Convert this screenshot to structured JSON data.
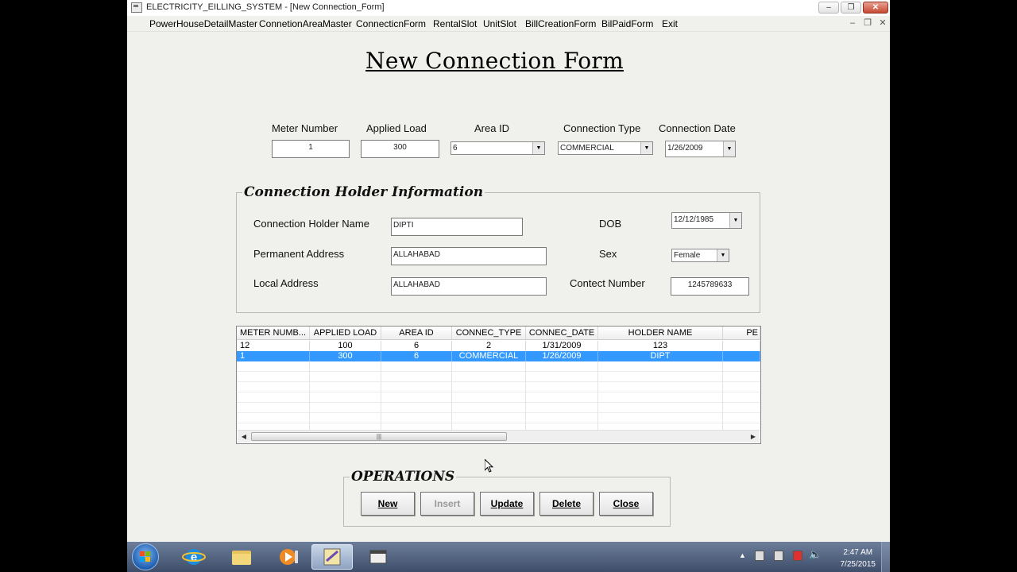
{
  "window": {
    "title": "ELECTRICITY_EILLING_SYSTEM - [New Connection_Form]"
  },
  "menu": [
    "PowerHouseDetailMaster",
    "ConnetionAreaMaster",
    "ConnecticnForm",
    "RentalSlot",
    "UnitSlot",
    "BillCreationForm",
    "BilPaidForm",
    "Exit"
  ],
  "form": {
    "title": "New Connection Form",
    "meter_number": {
      "label": "Meter Number",
      "value": "1"
    },
    "applied_load": {
      "label": "Applied Load",
      "value": "300"
    },
    "area_id": {
      "label": "Area ID",
      "value": "6"
    },
    "connection_type": {
      "label": "Connection Type",
      "value": "COMMERCIAL"
    },
    "connection_date": {
      "label": "Connection Date",
      "value": "1/26/2009"
    }
  },
  "holder": {
    "legend": "Connection Holder Information",
    "name": {
      "label": "Connection Holder Name",
      "value": "DIPTI"
    },
    "permanent_address": {
      "label": "Permanent Address",
      "value": "ALLAHABAD"
    },
    "local_address": {
      "label": "Local Address",
      "value": "ALLAHABAD"
    },
    "dob": {
      "label": "DOB",
      "value": "12/12/1985"
    },
    "sex": {
      "label": "Sex",
      "value": "Female"
    },
    "contact": {
      "label": "Contect Number",
      "value": "1245789633"
    }
  },
  "grid": {
    "columns": [
      "METER NUMB...",
      "APPLIED LOAD",
      "AREA ID",
      "CONNEC_TYPE",
      "CONNEC_DATE",
      "HOLDER NAME",
      "PE"
    ],
    "rows": [
      [
        "12",
        "100",
        "6",
        "2",
        "1/31/2009",
        "123"
      ],
      [
        "1",
        "300",
        "6",
        "COMMERCIAL",
        "1/26/2009",
        "DIPT"
      ]
    ],
    "selected_row": 1
  },
  "operations": {
    "legend": "OPERATIONS",
    "new": "New",
    "insert": "Insert",
    "update": "Update",
    "delete": "Delete",
    "close": "Close"
  },
  "taskbar": {
    "time": "2:47 AM",
    "date": "7/25/2015"
  }
}
